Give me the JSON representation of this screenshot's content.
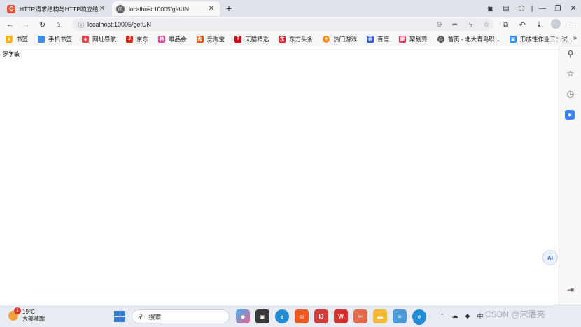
{
  "tabs": [
    {
      "title": "HTTP请求结构与HTTP响应结构",
      "icon": "csdn-icon",
      "color": "#e8553f",
      "active": false
    },
    {
      "title": "localhost:10005/getUN",
      "icon": "globe-icon",
      "active": true
    }
  ],
  "address_bar": {
    "url": "localhost:10005/getUN"
  },
  "bookmarks": [
    {
      "label": "书签",
      "icon": "star-icon",
      "color": "#f4b400"
    },
    {
      "label": "手机书签",
      "icon": "phone-icon",
      "color": "#3a8ee6"
    },
    {
      "label": "网址导航",
      "icon": "nav-icon",
      "color": "#e8414a"
    },
    {
      "label": "京东",
      "icon": "jd-icon",
      "color": "#e1251b"
    },
    {
      "label": "唯品会",
      "icon": "vip-icon",
      "color": "#e43d8c"
    },
    {
      "label": "爱淘宝",
      "icon": "taobao-icon",
      "color": "#ff4d00"
    },
    {
      "label": "天猫精选",
      "icon": "tmall-icon",
      "color": "#d9001b"
    },
    {
      "label": "东方头条",
      "icon": "dftt-icon",
      "color": "#d7282f"
    },
    {
      "label": "热门游戏",
      "icon": "game-icon",
      "color": "#f08c1e"
    },
    {
      "label": "百度",
      "icon": "baidu-icon",
      "color": "#2e5bdc"
    },
    {
      "label": "聚划算",
      "icon": "juhuasuan-icon",
      "color": "#e8335a"
    },
    {
      "label": "首页 - 北大青鸟职...",
      "icon": "globe-icon",
      "color": "#555555"
    },
    {
      "label": "形成性作业三：试...",
      "icon": "image-icon",
      "color": "#3a8ee6"
    }
  ],
  "page": {
    "text": "罗学敏"
  },
  "ai_button": {
    "label": "Ai"
  },
  "taskbar": {
    "weather": {
      "temp": "19°C",
      "desc": "大部晴朗",
      "badge": "1"
    },
    "search_placeholder": "搜索",
    "tray_lang": "中"
  },
  "watermark": "CSDN @宋潘亮"
}
